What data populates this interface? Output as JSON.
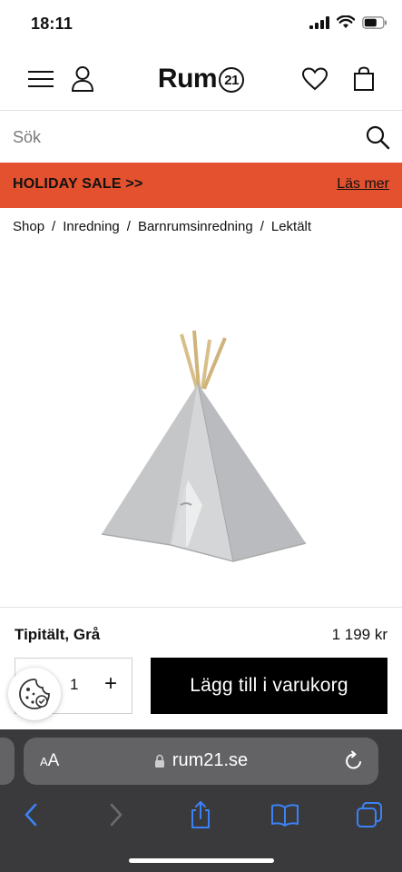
{
  "status": {
    "time": "18:11"
  },
  "header": {
    "logo_text": "Rum",
    "logo_number": "21"
  },
  "search": {
    "placeholder": "Sök"
  },
  "banner": {
    "text": "HOLIDAY SALE >>",
    "link": "Läs mer",
    "color": "#e3512f"
  },
  "breadcrumb": {
    "items": [
      "Shop",
      "Inredning",
      "Barnrumsinredning",
      "Lektält"
    ],
    "separator": "/"
  },
  "product": {
    "name": "Tipitält, Grå",
    "price": "1 199 kr",
    "quantity": "1",
    "plus_label": "+",
    "add_to_cart": "Lägg till i varukorg"
  },
  "browser": {
    "aa_label": "AA",
    "url": "rum21.se"
  }
}
